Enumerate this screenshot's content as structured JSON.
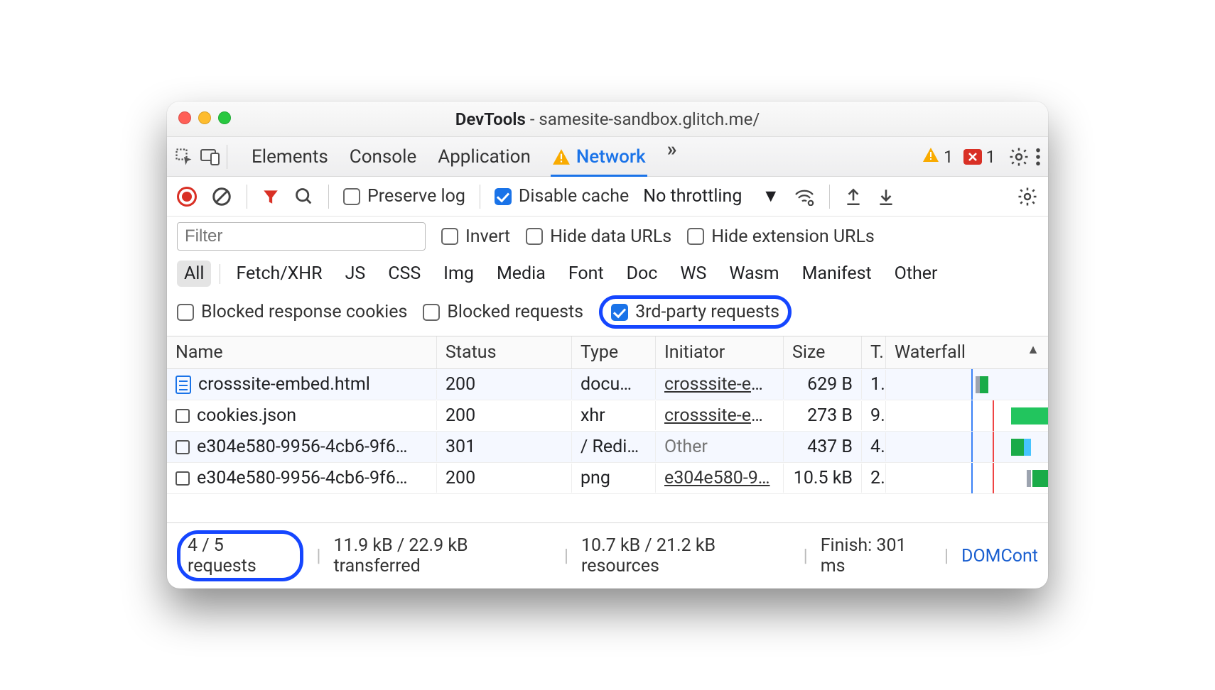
{
  "title": {
    "app": "DevTools",
    "sep": " - ",
    "url": "samesite-sandbox.glitch.me/"
  },
  "tabs": {
    "elements": "Elements",
    "console": "Console",
    "application": "Application",
    "network": "Network"
  },
  "counts": {
    "warnings": "1",
    "errors": "1"
  },
  "network_toolbar": {
    "preserve_log": "Preserve log",
    "disable_cache": "Disable cache",
    "no_throttling": "No throttling"
  },
  "filter_row": {
    "placeholder": "Filter",
    "invert": "Invert",
    "hide_data_urls": "Hide data URLs",
    "hide_ext_urls": "Hide extension URLs"
  },
  "type_filters": [
    "All",
    "Fetch/XHR",
    "JS",
    "CSS",
    "Img",
    "Media",
    "Font",
    "Doc",
    "WS",
    "Wasm",
    "Manifest",
    "Other"
  ],
  "extra_filters": {
    "blocked_cookies": "Blocked response cookies",
    "blocked_requests": "Blocked requests",
    "third_party": "3rd-party requests"
  },
  "columns": {
    "name": "Name",
    "status": "Status",
    "type": "Type",
    "initiator": "Initiator",
    "size": "Size",
    "time": "T.",
    "waterfall": "Waterfall"
  },
  "rows": [
    {
      "icon": "doc",
      "name": "crosssite-embed.html",
      "status": "200",
      "type": "docu…",
      "initiator": "crosssite-em…",
      "init_link": true,
      "size": "629 B",
      "time": "1.."
    },
    {
      "icon": "box",
      "name": "cookies.json",
      "status": "200",
      "type": "xhr",
      "initiator": "crosssite-em…",
      "init_link": true,
      "size": "273 B",
      "time": "9.."
    },
    {
      "icon": "box",
      "name": "e304e580-9956-4cb6-9f6…",
      "status": "301",
      "type": "/ Redi…",
      "initiator": "Other",
      "init_link": false,
      "size": "437 B",
      "time": "4.."
    },
    {
      "icon": "box",
      "name": "e304e580-9956-4cb6-9f6…",
      "status": "200",
      "type": "png",
      "initiator": "e304e580-9…",
      "init_link": true,
      "size": "10.5 kB",
      "time": "2.."
    }
  ],
  "status": {
    "requests": "4 / 5 requests",
    "transferred": "11.9 kB / 22.9 kB transferred",
    "resources": "10.7 kB / 21.2 kB resources",
    "finish": "Finish: 301 ms",
    "domcont": "DOMCont"
  }
}
